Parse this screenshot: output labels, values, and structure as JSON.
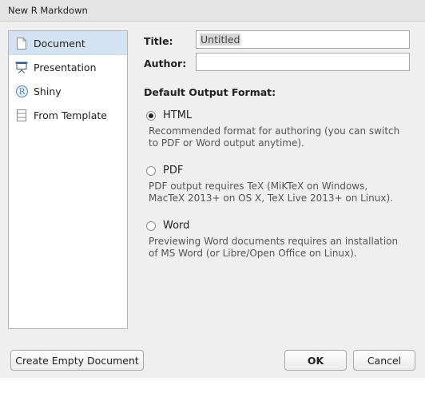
{
  "window": {
    "title": "New R Markdown"
  },
  "sidebar": {
    "items": [
      {
        "label": "Document",
        "icon": "document-icon",
        "selected": true
      },
      {
        "label": "Presentation",
        "icon": "presentation-icon",
        "selected": false
      },
      {
        "label": "Shiny",
        "icon": "shiny-icon",
        "selected": false
      },
      {
        "label": "From Template",
        "icon": "template-icon",
        "selected": false
      }
    ]
  },
  "form": {
    "title_label": "Title:",
    "title_value": "Untitled",
    "author_label": "Author:",
    "author_value": ""
  },
  "output": {
    "heading": "Default Output Format:",
    "options": [
      {
        "label": "HTML",
        "checked": true,
        "desc_line1": "Recommended format for authoring (you can switch",
        "desc_line2": "to PDF or Word output anytime)."
      },
      {
        "label": "PDF",
        "checked": false,
        "desc_line1": "PDF output requires TeX (MiKTeX on Windows,",
        "desc_line2": "MacTeX 2013+ on OS X, TeX Live 2013+ on Linux)."
      },
      {
        "label": "Word",
        "checked": false,
        "desc_line1": "Previewing Word documents requires an installation",
        "desc_line2": "of MS Word (or Libre/Open Office on Linux)."
      }
    ]
  },
  "buttons": {
    "create_empty": "Create Empty Document",
    "ok": "OK",
    "cancel": "Cancel"
  },
  "colors": {
    "selected_bg": "#d4e3f4",
    "dialog_bg": "#efefef",
    "shiny_icon": "#4a7ab8",
    "presentation_icon": "#3d5a80"
  }
}
